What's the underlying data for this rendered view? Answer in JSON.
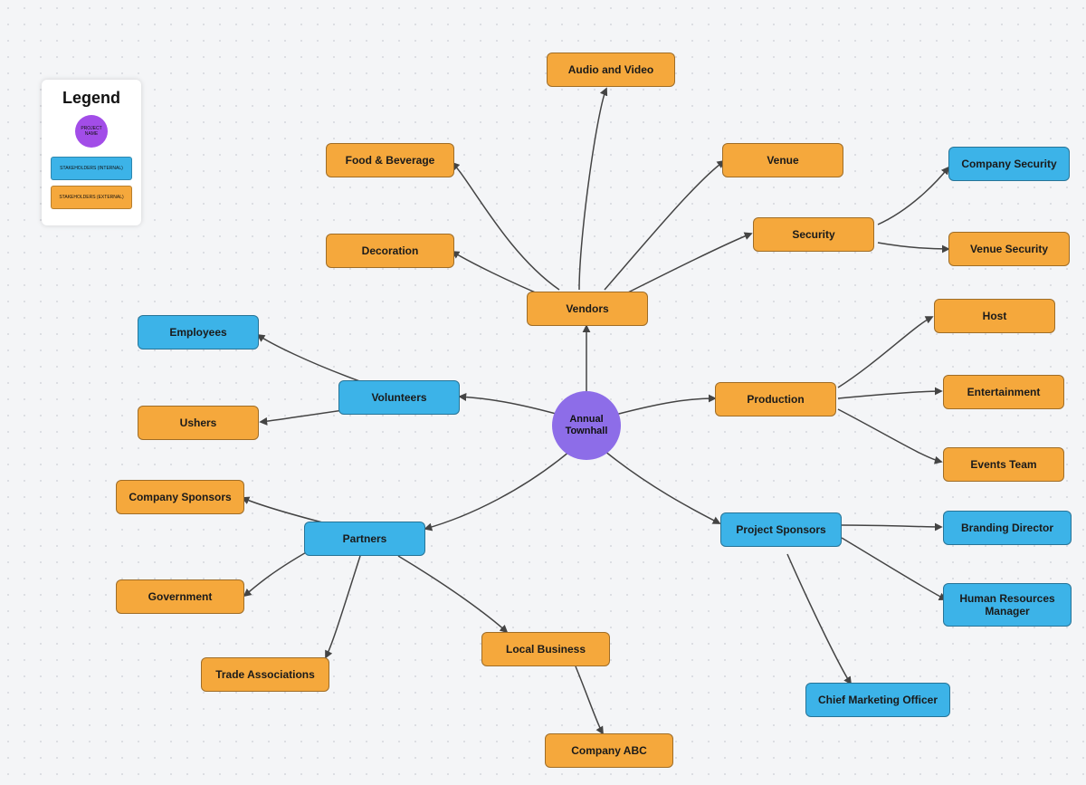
{
  "center": {
    "label": "Annual Townhall"
  },
  "legend": {
    "title": "Legend",
    "project": "PROJECT NAME",
    "internal": "STAKEHOLDERS (INTERNAL)",
    "external": "STAKEHOLDERS (EXTERNAL)"
  },
  "nodes": {
    "vendors": "Vendors",
    "foodBeverage": "Food & Beverage",
    "audioVideo": "Audio and Video",
    "venue": "Venue",
    "security": "Security",
    "companySecurity": "Company Security",
    "venueSecurity": "Venue Security",
    "decoration": "Decoration",
    "volunteers": "Volunteers",
    "employees": "Employees",
    "ushers": "Ushers",
    "production": "Production",
    "host": "Host",
    "entertainment": "Entertainment",
    "eventsTeam": "Events Team",
    "partners": "Partners",
    "companySponsors": "Company Sponsors",
    "government": "Government",
    "tradeAssociations": "Trade Associations",
    "localBusiness": "Local Business",
    "companyABC": "Company ABC",
    "projectSponsors": "Project Sponsors",
    "brandingDirector": "Branding Director",
    "hrManager": "Human Resources Manager",
    "cmo": "Chief Marketing Officer"
  },
  "colors": {
    "orange": "#f5a83c",
    "blue": "#3cb3e8",
    "purple": "#8d6de8"
  }
}
